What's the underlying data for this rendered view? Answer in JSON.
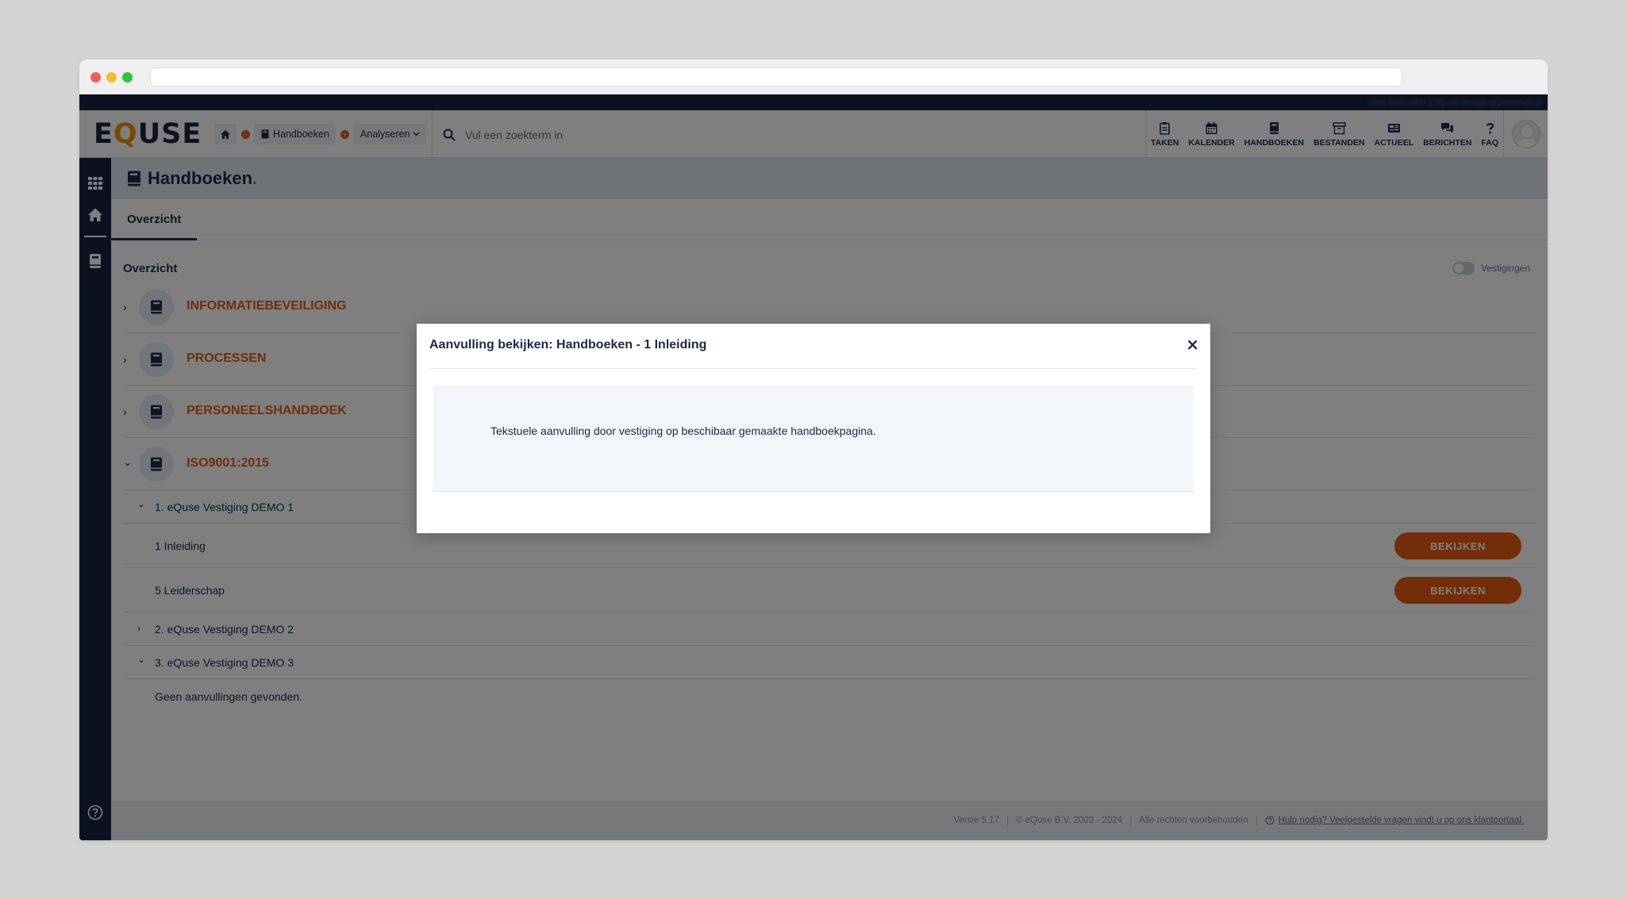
{
  "header": {
    "logo": "eQuse",
    "top_strip_text": "Web Gebruiker | eQuseVestigingDemoAdmin",
    "breadcrumb": {
      "item1": "Handboeken",
      "item2": "Analyseren"
    },
    "search_placeholder": "Vul een zoekterm in",
    "nav": [
      "TAKEN",
      "KALENDER",
      "HANDBOEKEN",
      "BESTANDEN",
      "ACTUEEL",
      "BERICHTEN",
      "FAQ"
    ]
  },
  "page": {
    "title": "Handboeken",
    "title_dot": ".",
    "tab": "Overzicht",
    "section_title": "Overzicht",
    "toggle_label": "Vestigingen"
  },
  "categories": [
    "INFORMATIEBEVEILIGING",
    "PROCESSEN",
    "PERSONEELSHANDBOEK",
    "ISO9001:2015"
  ],
  "iso_tree": {
    "vestiging1": "1. eQuse Vestiging DEMO 1",
    "page1": "1 Inleiding",
    "page2": "5 Leiderschap",
    "vestiging2": "2. eQuse Vestiging DEMO 2",
    "vestiging3": "3. eQuse Vestiging DEMO 3",
    "empty_message": "Geen aanvullingen gevonden.",
    "view_button": "BEKIJKEN"
  },
  "footer": {
    "version": "Versie 5.17",
    "copyright": "© eQuse B.V. 2003 - 2024",
    "rights": "Alle rechten voorbehouden",
    "help_link": "Hulp nodig? Veelgestelde vragen vindt u op ons klantportaal."
  },
  "modal": {
    "title": "Aanvulling bekijken: Handboeken - 1 Inleiding",
    "close": "×",
    "body": "Tekstuele aanvulling door vestiging op beschibaar gemaakte handboekpagina."
  },
  "colors": {
    "navy": "#182245",
    "accent_orange": "#e65a10",
    "logo_q": "#f29200"
  }
}
